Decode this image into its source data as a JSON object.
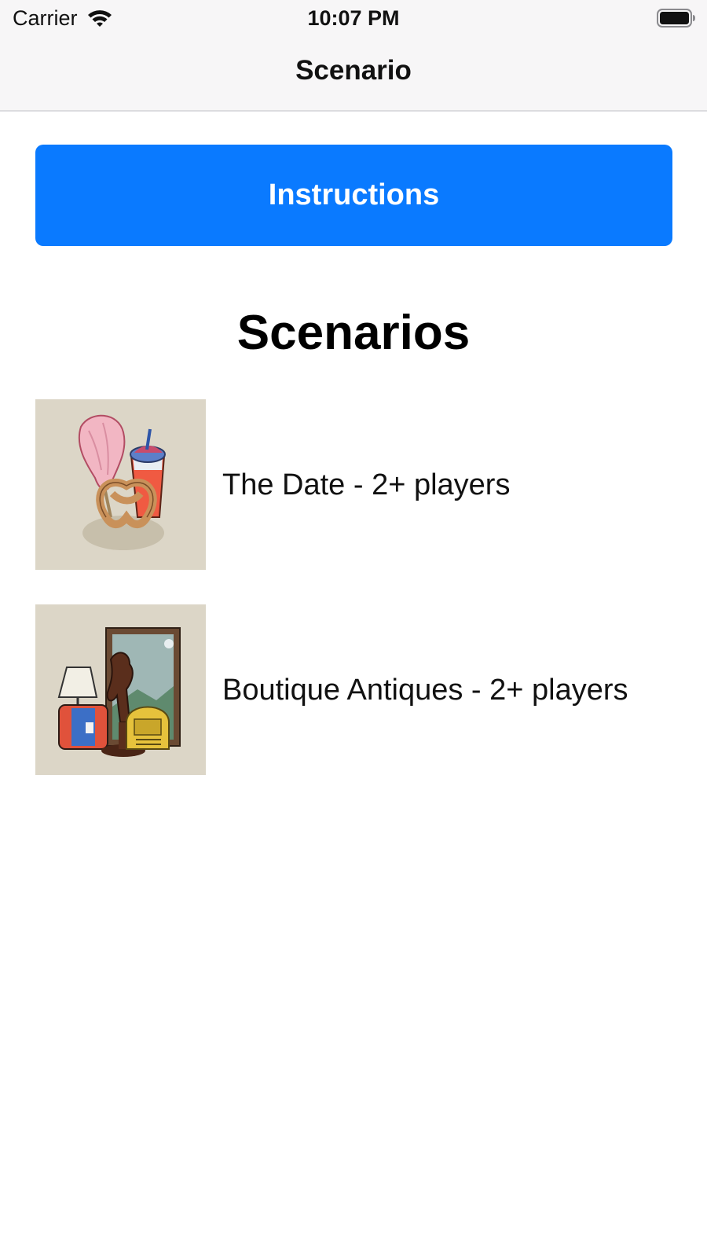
{
  "status_bar": {
    "carrier": "Carrier",
    "time": "10:07 PM",
    "wifi_icon": "wifi-icon",
    "battery_icon": "battery-icon"
  },
  "nav": {
    "title": "Scenario"
  },
  "instructions_button": {
    "label": "Instructions",
    "color": "#0a7aff"
  },
  "section": {
    "title": "Scenarios"
  },
  "scenarios": [
    {
      "label": "The Date - 2+ players",
      "icon": "date-snacks-icon"
    },
    {
      "label": "Boutique Antiques - 2+ players",
      "icon": "antiques-icon"
    }
  ]
}
